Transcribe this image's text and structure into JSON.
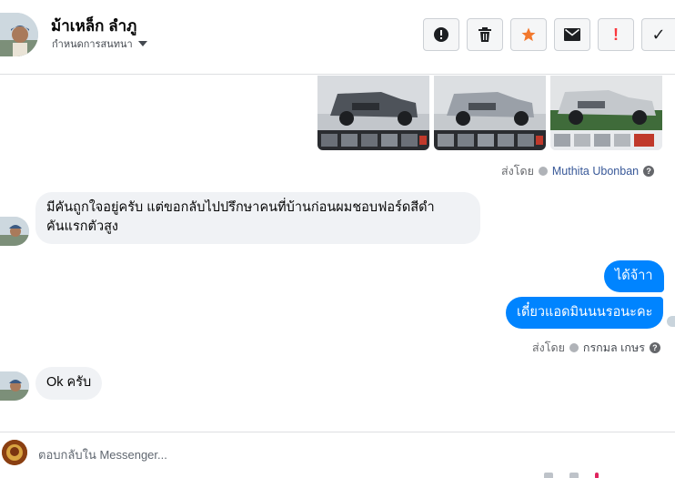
{
  "header": {
    "contact_name": "ม้าเหล็ก ลำภู",
    "conversation_label": "กำหนดการสนทนา",
    "buttons": [
      {
        "name": "alert-circle-icon",
        "color": "#1c1e21"
      },
      {
        "name": "trash-icon",
        "color": "#1c1e21"
      },
      {
        "name": "star-icon",
        "color": "#f2782d"
      },
      {
        "name": "envelope-icon",
        "color": "#1c1e21"
      },
      {
        "name": "exclamation-icon",
        "color": "#fa383e"
      },
      {
        "name": "check-icon",
        "color": "#1c1e21"
      }
    ],
    "exclamation_glyph": "!",
    "check_glyph": "✓"
  },
  "thread": {
    "attachments": [
      {
        "name": "truck-photo-1",
        "body_color": "#5b5f66"
      },
      {
        "name": "truck-photo-2",
        "body_color": "#9aa0a8"
      },
      {
        "name": "truck-photo-3",
        "body_color": "#c4c8cc"
      }
    ],
    "sent_by_1": {
      "prefix": "ส่งโดย",
      "person": "Muthita Ubonban",
      "help": "?"
    },
    "incoming_1": {
      "line1": "มีคันถูกใจอยู่ครับ  แต่ขอกลับไปปรึกษาคนที่บ้านก่อนผมชอบฟอร์ดสีดำ",
      "line2": "คันแรกตัวสูง"
    },
    "outgoing_1": "ได้จ้าา",
    "outgoing_2": "เดี๋ยวแอดมินนนรอนะคะ",
    "sent_by_2": {
      "prefix": "ส่งโดย",
      "person": "กรกมล เกษร",
      "help": "?"
    },
    "incoming_2": "Ok ครับ"
  },
  "composer": {
    "placeholder": "ตอบกลับใน Messenger..."
  },
  "colors": {
    "outgoing_bubble": "#0084ff",
    "incoming_bubble": "#f0f2f5",
    "link": "#385898"
  }
}
